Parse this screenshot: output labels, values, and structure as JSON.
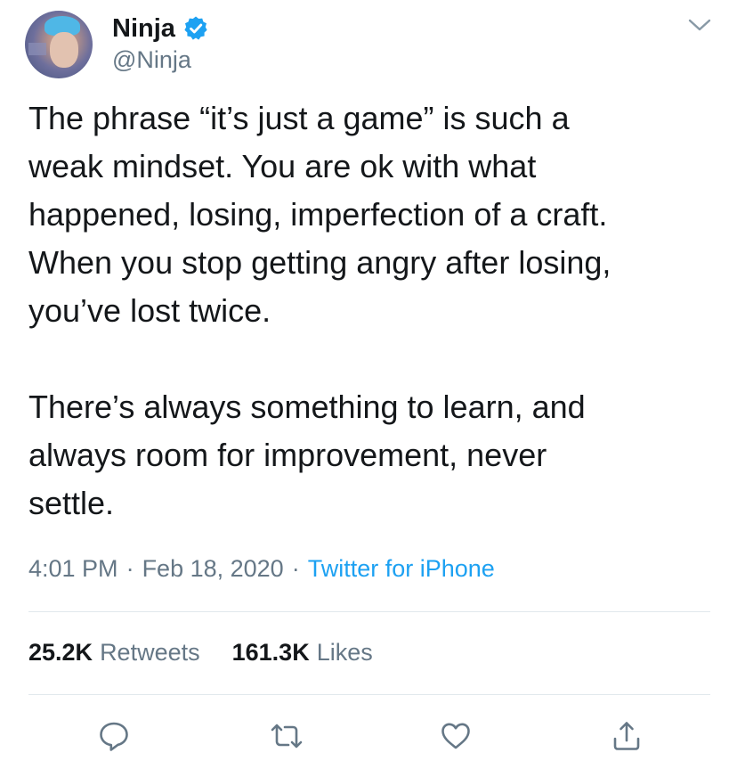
{
  "author": {
    "display_name": "Ninja",
    "handle": "@Ninja",
    "verified": true
  },
  "tweet": {
    "text": "The phrase “it’s just a game” is such a\nweak mindset. You are ok with what\nhappened, losing, imperfection of a craft.\nWhen you stop getting angry after losing,\nyou’ve lost twice.\n\nThere’s always something to learn, and\nalways room for improvement, never\nsettle.",
    "time": "4:01 PM",
    "date": "Feb 18, 2020",
    "source": "Twitter for iPhone",
    "separator": "·"
  },
  "stats": {
    "retweets_count": "25.2K",
    "retweets_label": "Retweets",
    "likes_count": "161.3K",
    "likes_label": "Likes"
  },
  "actions": [
    "reply-icon",
    "retweet-icon",
    "like-icon",
    "share-icon"
  ],
  "colors": {
    "text": "#14171a",
    "secondary": "#657786",
    "link": "#1da1f2",
    "divider": "#e1e8ed",
    "icon": "#657786",
    "verified_badge": "#1da1f2"
  }
}
